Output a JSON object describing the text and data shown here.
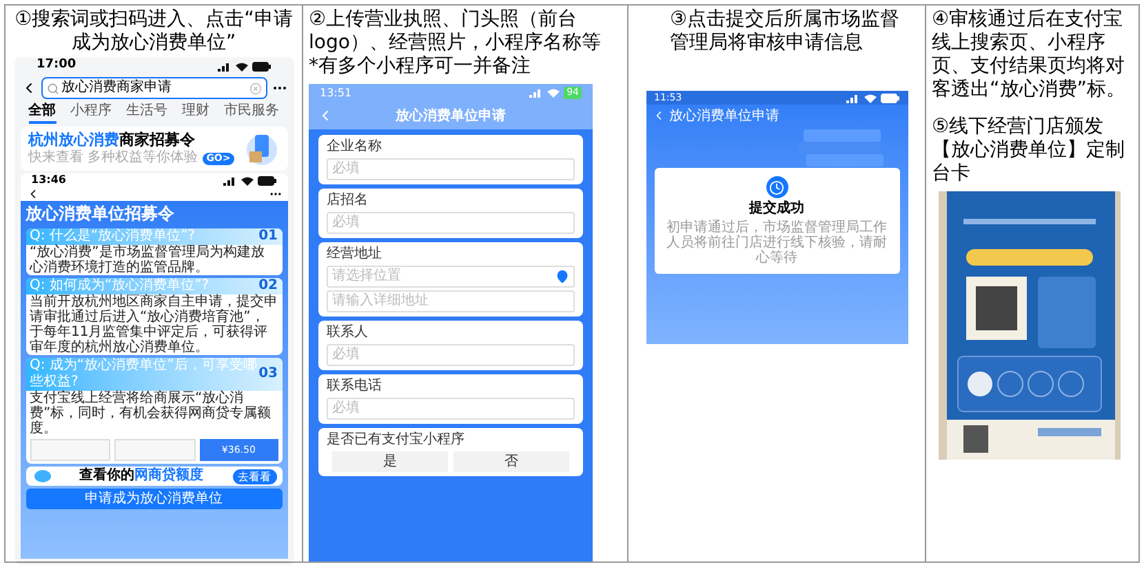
{
  "panel_1": {
    "caption": "①搜索词或扫码进入、点击“申请成为放心消费单位”",
    "phone": {
      "time": "17:00",
      "search_query": "放心消费商家申请",
      "tabs": [
        {
          "label": "全部",
          "selected": true
        },
        {
          "label": "小程序",
          "selected": false
        },
        {
          "label": "生活号",
          "selected": false
        },
        {
          "label": "理财",
          "selected": false
        },
        {
          "label": "市民服务",
          "selected": false
        }
      ],
      "banner": {
        "title_highlight": "杭州放心消费",
        "title_rest": "商家招募令",
        "subtitle": "快来查看 多种权益等你体验",
        "badge": "GO>"
      },
      "inner": {
        "time": "13:46",
        "title": "放心消费单位招募令",
        "qa": [
          {
            "question": "Q: 什么是“放心消费单位”?",
            "number": "01",
            "answer": "“放心消费”是市场监督管理局为构建放心消费环境打造的监管品牌。"
          },
          {
            "question": "Q: 如何成为“放心消费单位”?",
            "number": "02",
            "answer": "当前开放杭州地区商家自主申请，提交申请审批通过后进入“放心消费培育池”，于每年11月监管集中评定后，可获得评审年度的杭州放心消费单位。"
          },
          {
            "question": "Q: 成为“放心消费单位”后，可享受哪些权益?",
            "number": "03",
            "answer": "支付宝线上经营将给商展示“放心消费”标，同时，有机会获得网商贷专属额度。",
            "thumbnail_amount": "¥36.50"
          }
        ],
        "promo": {
          "text_prefix": "查看你的",
          "text_highlight": "网商贷额度",
          "button": "去看看"
        },
        "apply_button": "申请成为放心消费单位"
      }
    }
  },
  "panel_2": {
    "caption": "②上传营业执照、门头照（前台logo）、经营照片，小程序名称等",
    "note": "*有多个小程序可一并备注",
    "phone": {
      "time": "13:51",
      "battery": "94",
      "title": "放心消费单位申请",
      "fields": [
        {
          "label": "企业名称",
          "inputs": [
            {
              "kind": "text",
              "placeholder": "必填"
            }
          ]
        },
        {
          "label": "店招名",
          "inputs": [
            {
              "kind": "text",
              "placeholder": "必填"
            }
          ]
        },
        {
          "label": "经营地址",
          "inputs": [
            {
              "kind": "location",
              "placeholder": "请选择位置"
            },
            {
              "kind": "text",
              "placeholder": "请输入详细地址"
            }
          ]
        },
        {
          "label": "联系人",
          "inputs": [
            {
              "kind": "text",
              "placeholder": "必填"
            }
          ]
        },
        {
          "label": "联系电话",
          "inputs": [
            {
              "kind": "text",
              "placeholder": "必填"
            }
          ]
        }
      ],
      "question": {
        "label": "是否已有支付宝小程序",
        "options": [
          "是",
          "否"
        ]
      }
    }
  },
  "panel_3": {
    "caption": "③点击提交后所属市场监督管理局将审核申请信息",
    "phone": {
      "time": "11:53",
      "title": "放心消费单位申请",
      "result_title": "提交成功",
      "result_text": "初申请通过后，市场监督管理局工作人员将前往门店进行线下核验，请耐心等待"
    }
  },
  "panel_4": {
    "captions": [
      "④审核通过后在支付宝线上搜索页、小程序页、支付结果页均将对客透出“放心消费”标。",
      "⑤线下经营门店颁发【放心消费单位】定制台卡"
    ],
    "photo": {
      "kind": "picture"
    }
  }
}
